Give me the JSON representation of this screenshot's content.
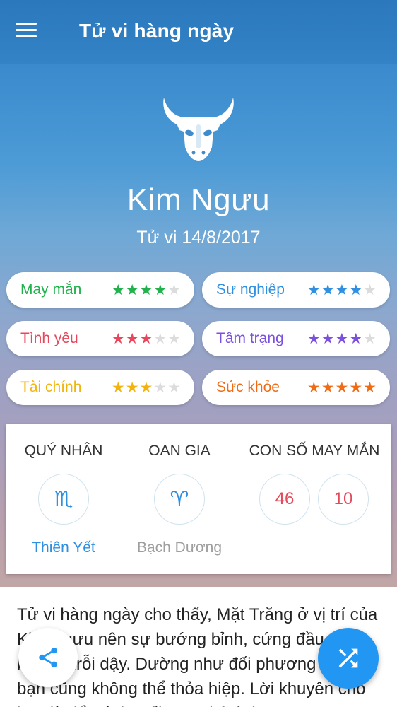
{
  "header": {
    "title": "Tử vi hàng ngày"
  },
  "sign": {
    "icon": "taurus-bull-icon",
    "name": "Kim Ngưu",
    "date": "Tử vi 14/8/2017"
  },
  "ratings": [
    {
      "label": "May mắn",
      "score": 4,
      "max": 5,
      "color": "#22b14c"
    },
    {
      "label": "Sự nghiệp",
      "score": 4,
      "max": 5,
      "color": "#2f8fe0"
    },
    {
      "label": "Tình yêu",
      "score": 3,
      "max": 5,
      "color": "#e8465a"
    },
    {
      "label": "Tâm trạng",
      "score": 4,
      "max": 5,
      "color": "#7b4fe0"
    },
    {
      "label": "Tài chính",
      "score": 3,
      "max": 5,
      "color": "#f2b40c"
    },
    {
      "label": "Sức khỏe",
      "score": 5,
      "max": 5,
      "color": "#f26b12"
    }
  ],
  "info": {
    "benefactor": {
      "heading": "QUÝ NHÂN",
      "symbol": "♏",
      "name": "Thiên Yết",
      "color": "#2f8fe0"
    },
    "enemy": {
      "heading": "OAN GIA",
      "symbol": "♈",
      "name": "Bạch Dương",
      "color": "#9e9e9e"
    },
    "lucky_numbers": {
      "heading": "CON SỐ MAY MẮN",
      "values": [
        "46",
        "10"
      ]
    }
  },
  "content": {
    "text": "Tử vi hàng ngày cho thấy, Mặt Trăng ở vị trí của Kim Ngưu nên sự bướng bỉnh, cứng đầu của bạn lại trỗi dậy. Dường như đối phương nói gì bạn cũng không thể thỏa hiệp. Lời khuyên cho bạn là để tránh mối quan hệ tình"
  },
  "actions": {
    "share_icon": "share-icon",
    "shuffle_icon": "shuffle-icon"
  }
}
